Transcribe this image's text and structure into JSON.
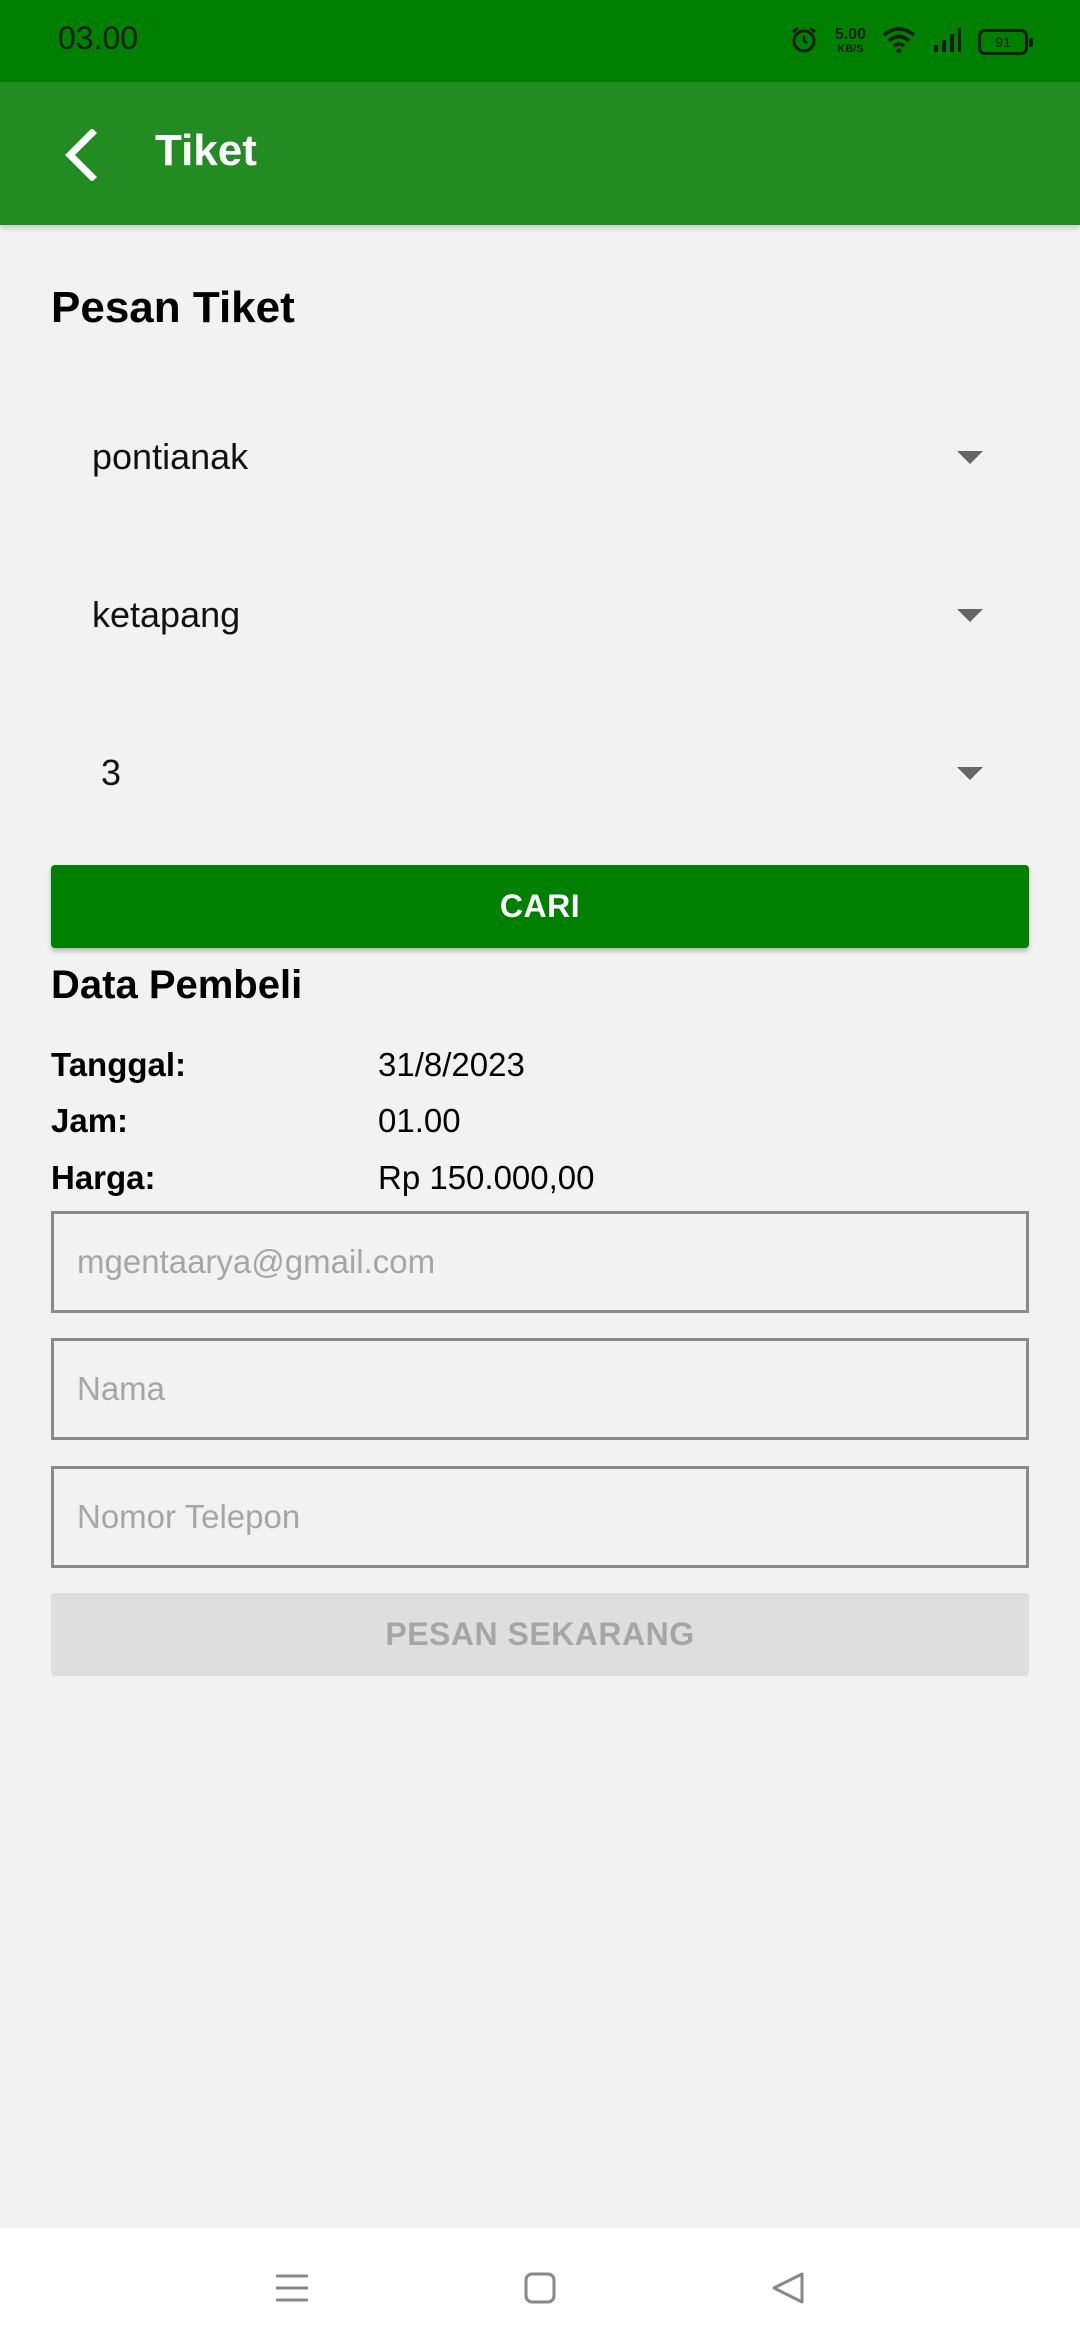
{
  "status_bar": {
    "time": "03.00",
    "net_speed_value": "5.00",
    "net_speed_unit": "KB/S",
    "battery": "91"
  },
  "app_bar": {
    "title": "Tiket"
  },
  "order": {
    "section_title": "Pesan Tiket",
    "origin": "pontianak",
    "destination": "ketapang",
    "quantity": "3",
    "search_label": "CARI"
  },
  "buyer": {
    "section_title": "Data Pembeli",
    "date_label": "Tanggal:",
    "date_value": "31/8/2023",
    "time_label": "Jam:",
    "time_value": "01.00",
    "price_label": "Harga:",
    "price_value": "Rp 150.000,00",
    "email_placeholder": "mgentaarya@gmail.com",
    "name_placeholder": "Nama",
    "phone_placeholder": "Nomor Telepon",
    "submit_label": "PESAN SEKARANG"
  }
}
